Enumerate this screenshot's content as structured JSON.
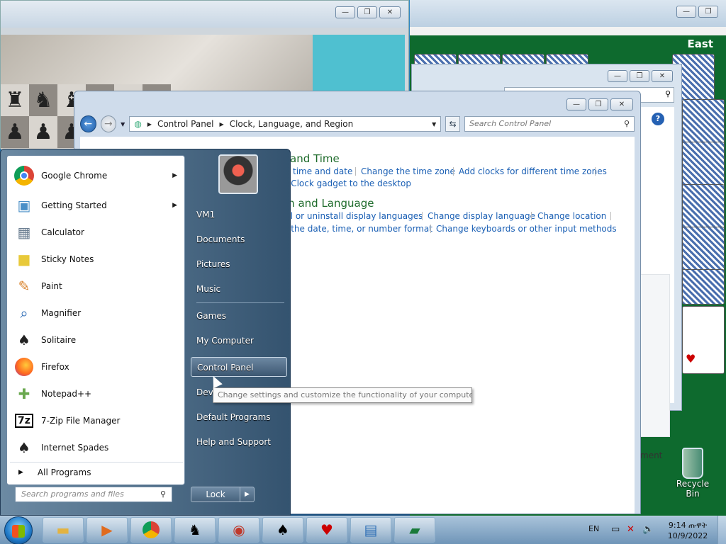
{
  "solitaire": {
    "east_label": "East"
  },
  "control_panel": {
    "breadcrumb": [
      "Control Panel",
      "Clock, Language, and Region"
    ],
    "search_placeholder": "Search Control Panel",
    "sections": [
      {
        "title": "and Time",
        "links": [
          "time and date",
          "Change the time zone",
          "Add clocks for different time zones",
          "e Clock gadget to the desktop"
        ]
      },
      {
        "title": "on and Language",
        "links": [
          "all or uninstall display languages",
          "Change display language",
          "Change location",
          "e the date, time, or number format",
          "Change keyboards or other input methods"
        ]
      }
    ]
  },
  "start_menu": {
    "programs": [
      {
        "label": "Google Chrome",
        "icon": "chrome-icon",
        "submenu": true
      },
      {
        "label": "Getting Started",
        "icon": "getting-started-icon",
        "submenu": true
      },
      {
        "label": "Calculator",
        "icon": "calculator-icon",
        "submenu": false
      },
      {
        "label": "Sticky Notes",
        "icon": "sticky-notes-icon",
        "submenu": false
      },
      {
        "label": "Paint",
        "icon": "paint-icon",
        "submenu": false
      },
      {
        "label": "Magnifier",
        "icon": "magnifier-icon",
        "submenu": false
      },
      {
        "label": "Solitaire",
        "icon": "solitaire-icon",
        "submenu": false
      },
      {
        "label": "Firefox",
        "icon": "firefox-icon",
        "submenu": false
      },
      {
        "label": "Notepad++",
        "icon": "notepad-plus-icon",
        "submenu": false
      },
      {
        "label": "7-Zip File Manager",
        "icon": "7zip-icon",
        "submenu": false
      },
      {
        "label": "Internet Spades",
        "icon": "spades-icon",
        "submenu": false
      }
    ],
    "all_programs": "All Programs",
    "search_placeholder": "Search programs and files",
    "right_items": [
      "VM1",
      "Documents",
      "Pictures",
      "Music",
      "Games",
      "My Computer",
      "Control Panel",
      "Devices and Printers",
      "Default Programs",
      "Help and Support"
    ],
    "lock_label": "Lock"
  },
  "tooltip": "Change settings and customize the functionality of your computer.",
  "desktop": {
    "recycle_bin": "Recycle Bin",
    "partial_text": "ment"
  },
  "tray": {
    "language": "EN",
    "time": "9:14 ጡዋት",
    "date": "10/9/2022"
  }
}
